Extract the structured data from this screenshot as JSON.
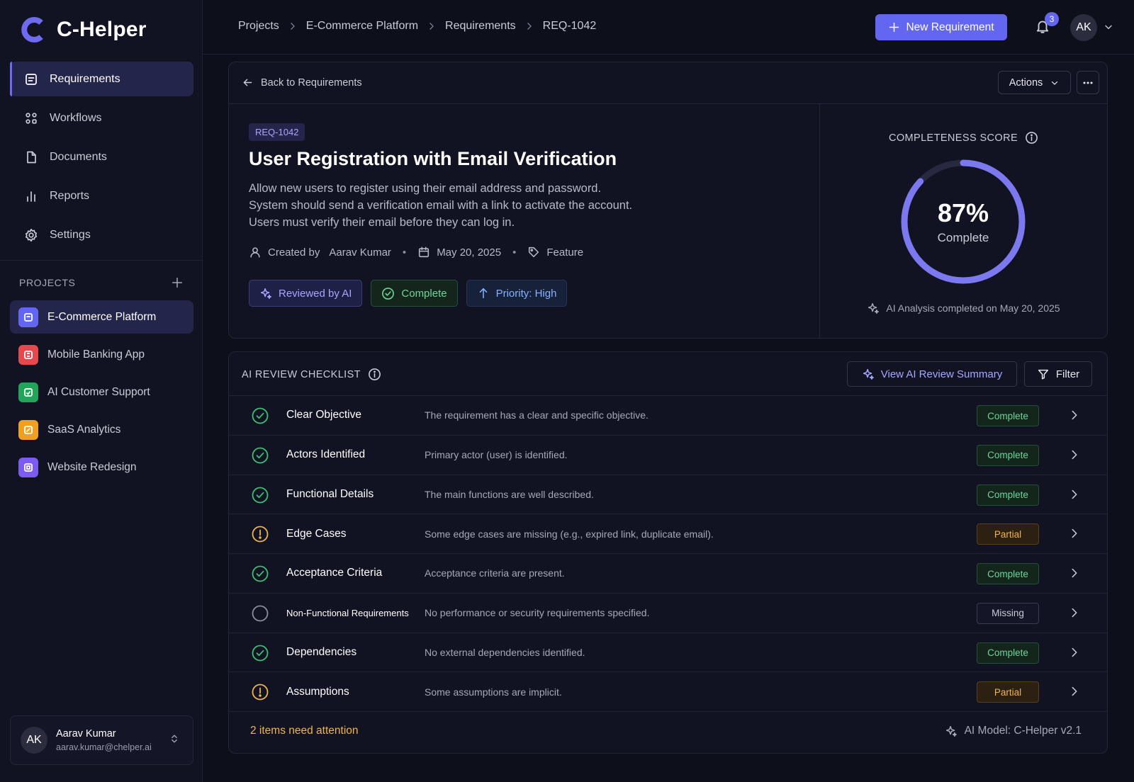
{
  "app": {
    "name": "C-Helper"
  },
  "sidebar": {
    "nav": [
      {
        "label": "Requirements",
        "icon": "list-doc-icon",
        "active": true
      },
      {
        "label": "Workflows",
        "icon": "workflow-icon",
        "active": false
      },
      {
        "label": "Documents",
        "icon": "document-icon",
        "active": false
      },
      {
        "label": "Reports",
        "icon": "bar-chart-icon",
        "active": false
      },
      {
        "label": "Settings",
        "icon": "gear-icon",
        "active": false
      }
    ],
    "projects_title": "PROJECTS",
    "projects": [
      {
        "label": "E-Commerce Platform",
        "color": "#6366f1",
        "active": true
      },
      {
        "label": "Mobile Banking App",
        "color": "#e5484d",
        "active": false
      },
      {
        "label": "AI Customer Support",
        "color": "#22a55b",
        "active": false
      },
      {
        "label": "SaaS Analytics",
        "color": "#f0a020",
        "active": false
      },
      {
        "label": "Website Redesign",
        "color": "#7c5cf0",
        "active": false
      }
    ],
    "user": {
      "initials": "AK",
      "name": "Aarav Kumar",
      "email": "aarav.kumar@chelper.ai"
    }
  },
  "topbar": {
    "breadcrumb": [
      "Projects",
      "E-Commerce Platform",
      "Requirements",
      "REQ-1042"
    ],
    "new_button": "New Requirement",
    "notification_count": "3",
    "avatar_initials": "AK"
  },
  "detail": {
    "back_label": "Back to Requirements",
    "actions_label": "Actions",
    "req_id": "REQ-1042",
    "title": "User Registration with Email Verification",
    "description": [
      "Allow new users to register using their email address and password.",
      "System should send a verification email with a link to activate the account.",
      "Users must verify their email before they can log in."
    ],
    "created_by_label": "Created by",
    "created_by": "Aarav Kumar",
    "date": "May 20, 2025",
    "tag": "Feature",
    "chips": {
      "reviewed": "Reviewed by AI",
      "status": "Complete",
      "priority": "Priority: High"
    },
    "score": {
      "title": "COMPLETENESS SCORE",
      "value": 87,
      "value_text": "87%",
      "label": "Complete",
      "analysis": "AI Analysis completed on May 20, 2025",
      "accent": "#7b78f0"
    }
  },
  "checklist": {
    "title": "AI REVIEW CHECKLIST",
    "view_summary": "View AI Review Summary",
    "filter": "Filter",
    "items": [
      {
        "name": "Clear Objective",
        "desc": "The requirement has a clear and specific objective.",
        "status": "Complete",
        "kind": "complete"
      },
      {
        "name": "Actors Identified",
        "desc": "Primary actor (user) is identified.",
        "status": "Complete",
        "kind": "complete"
      },
      {
        "name": "Functional Details",
        "desc": "The main functions are well described.",
        "status": "Complete",
        "kind": "complete"
      },
      {
        "name": "Edge Cases",
        "desc": "Some edge cases are missing (e.g., expired link, duplicate email).",
        "status": "Partial",
        "kind": "partial"
      },
      {
        "name": "Acceptance Criteria",
        "desc": "Acceptance criteria are present.",
        "status": "Complete",
        "kind": "complete"
      },
      {
        "name": "Non-Functional Requirements",
        "desc": "No performance or security requirements specified.",
        "status": "Missing",
        "kind": "missing"
      },
      {
        "name": "Dependencies",
        "desc": "No external dependencies identified.",
        "status": "Complete",
        "kind": "complete"
      },
      {
        "name": "Assumptions",
        "desc": "Some assumptions are implicit.",
        "status": "Partial",
        "kind": "partial"
      }
    ],
    "attention": "2 items need attention",
    "model": "AI Model: C-Helper v2.1"
  }
}
